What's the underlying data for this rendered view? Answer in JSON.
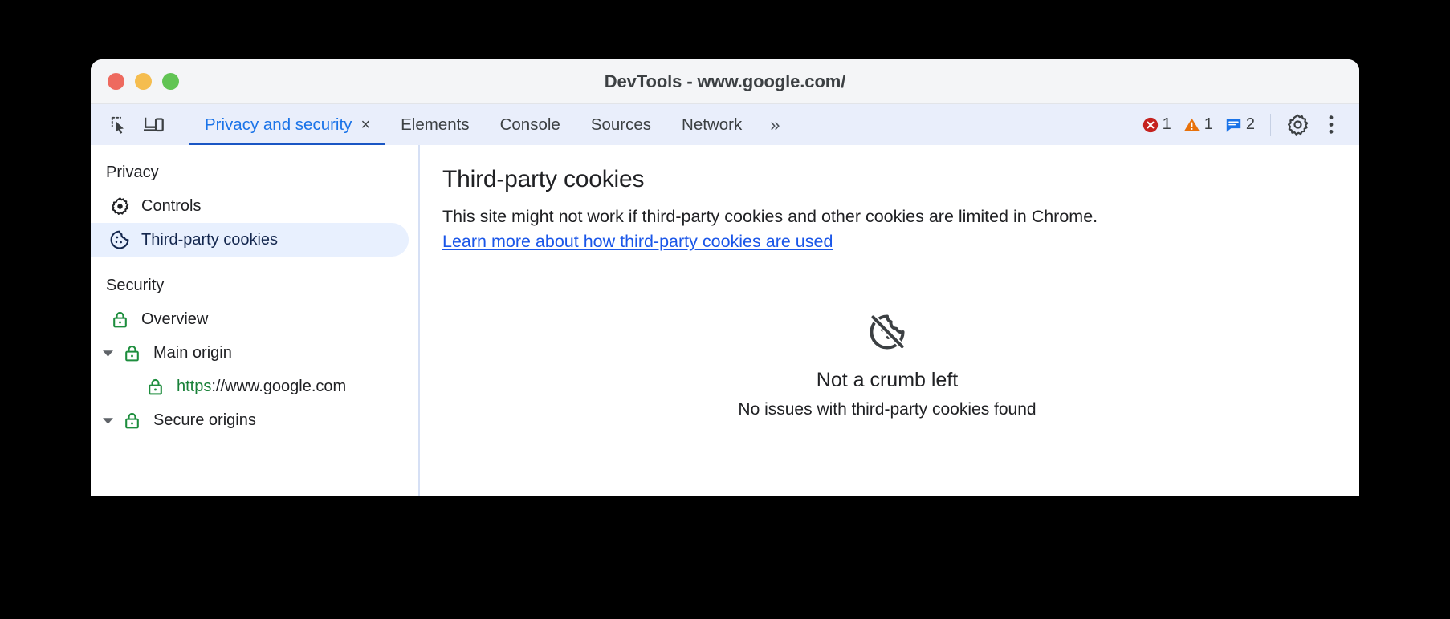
{
  "window": {
    "title": "DevTools - www.google.com/",
    "traffic_lights": [
      {
        "name": "close",
        "color": "#ee6a5f"
      },
      {
        "name": "minimize",
        "color": "#f5bd4f"
      },
      {
        "name": "maximize",
        "color": "#61c454"
      }
    ]
  },
  "toolbar": {
    "inspect_icon": "inspect-element-icon",
    "device_icon": "device-toolbar-icon",
    "tabs": [
      {
        "label": "Privacy and security",
        "active": true,
        "closable": true
      },
      {
        "label": "Elements",
        "active": false,
        "closable": false
      },
      {
        "label": "Console",
        "active": false,
        "closable": false
      },
      {
        "label": "Sources",
        "active": false,
        "closable": false
      },
      {
        "label": "Network",
        "active": false,
        "closable": false
      }
    ],
    "close_glyph": "×",
    "more_tabs_glyph": "»",
    "badges": [
      {
        "name": "errors",
        "icon": "error-icon",
        "count": "1",
        "color": "#c5221f"
      },
      {
        "name": "warnings",
        "icon": "warning-icon",
        "count": "1",
        "color": "#e8710a"
      },
      {
        "name": "messages",
        "icon": "message-icon",
        "count": "2",
        "color": "#1a73e8"
      }
    ],
    "settings_icon": "gear-icon",
    "more_options_icon": "kebab-menu-icon"
  },
  "sidebar": {
    "sections": [
      {
        "title": "Privacy",
        "items": [
          {
            "label": "Controls",
            "icon": "gear-icon",
            "selected": false,
            "twisty": false,
            "child": false
          },
          {
            "label": "Third-party cookies",
            "icon": "cookie-icon",
            "selected": true,
            "twisty": false,
            "child": false
          }
        ]
      },
      {
        "title": "Security",
        "items": [
          {
            "label": "Overview",
            "icon": "lock-icon",
            "selected": false,
            "twisty": false,
            "child": false
          },
          {
            "label": "Main origin",
            "icon": "lock-icon",
            "selected": false,
            "twisty": true,
            "child": false
          },
          {
            "label": "https://www.google.com",
            "scheme": "https",
            "rest": "://www.google.com",
            "icon": "lock-icon",
            "selected": false,
            "twisty": false,
            "child": true
          },
          {
            "label": "Secure origins",
            "icon": "lock-icon",
            "selected": false,
            "twisty": true,
            "child": false
          }
        ]
      }
    ],
    "lock_color": "#1e8e3e"
  },
  "main": {
    "heading": "Third-party cookies",
    "description_before": "This site might not work if third-party cookies and other cookies are limited in Chrome. ",
    "link_text": "Learn more about how third-party cookies are used",
    "empty_state": {
      "icon": "cookie-off-icon",
      "title": "Not a crumb left",
      "subtitle": "No issues with third-party cookies found"
    }
  }
}
